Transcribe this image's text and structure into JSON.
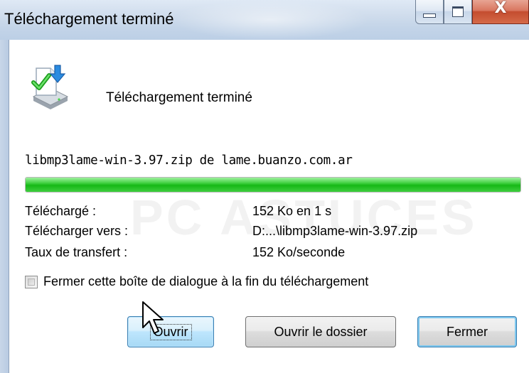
{
  "window": {
    "title": "Téléchargement terminé"
  },
  "caption_buttons": {
    "minimize_icon": "minimize-icon",
    "maximize_icon": "maximize-icon",
    "close_glyph": "X"
  },
  "status": {
    "icon": "download-complete-icon",
    "text": "Téléchargement terminé"
  },
  "download": {
    "source": "libmp3lame-win-3.97.zip de lame.buanzo.com.ar",
    "progress": 1.0,
    "progress_color": "#16b816"
  },
  "details": [
    {
      "label": "Téléchargé :",
      "value": "152 Ko en 1 s"
    },
    {
      "label": "Télécharger vers :",
      "value": "D:...\\libmp3lame-win-3.97.zip"
    },
    {
      "label": "Taux de transfert :",
      "value": "152 Ko/seconde"
    }
  ],
  "options": {
    "close_on_finish_label": "Fermer cette boîte de dialogue à la fin du téléchargement",
    "close_on_finish_checked": false
  },
  "buttons": {
    "open_label": "Ouvrir",
    "open_folder_label": "Ouvrir le dossier",
    "close_label": "Fermer"
  },
  "watermark": "PC ASTUCES",
  "colors": {
    "title_bar": "#c3d4e8",
    "close_button": "#c44c2f",
    "focus_button_border": "#3c7fb1"
  }
}
